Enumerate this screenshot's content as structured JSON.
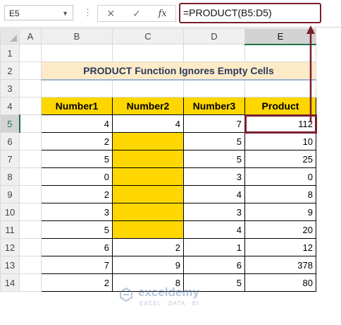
{
  "formula_bar": {
    "name_box": "E5",
    "formula": "=PRODUCT(B5:D5)",
    "cancel_icon": "close-icon",
    "enter_icon": "check-icon",
    "fx_label": "fx"
  },
  "columns": [
    "A",
    "B",
    "C",
    "D",
    "E"
  ],
  "rows": [
    "1",
    "2",
    "3",
    "4",
    "5",
    "6",
    "7",
    "8",
    "9",
    "10",
    "11",
    "12",
    "13",
    "14"
  ],
  "title": "PRODUCT Function Ignores Empty Cells",
  "table": {
    "headers": [
      "Number1",
      "Number2",
      "Number3",
      "Product"
    ],
    "rows": [
      [
        "4",
        "4",
        "7",
        "112"
      ],
      [
        "2",
        "",
        "5",
        "10"
      ],
      [
        "5",
        "",
        "5",
        "25"
      ],
      [
        "0",
        "",
        "3",
        "0"
      ],
      [
        "2",
        "",
        "4",
        "8"
      ],
      [
        "3",
        "",
        "3",
        "9"
      ],
      [
        "5",
        "",
        "4",
        "20"
      ],
      [
        "6",
        "2",
        "1",
        "12"
      ],
      [
        "7",
        "9",
        "6",
        "378"
      ],
      [
        "2",
        "8",
        "5",
        "80"
      ]
    ]
  },
  "watermark": {
    "name": "exceldemy",
    "tagline": "EXCEL · DATA · BI"
  },
  "colors": {
    "highlight": "#fed700",
    "title_bg": "#fdebc8",
    "accent_box": "#7a1f2b"
  }
}
